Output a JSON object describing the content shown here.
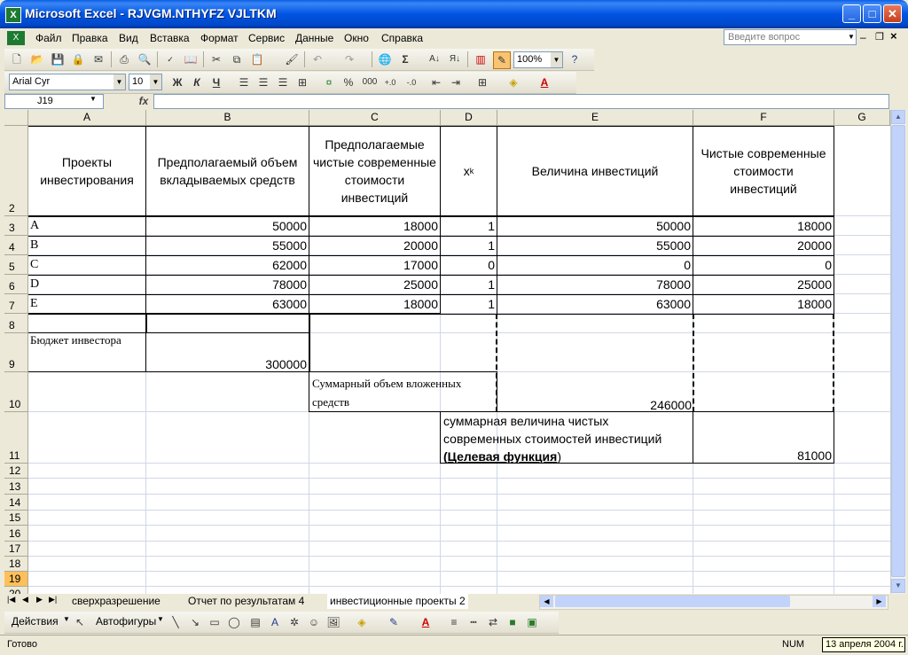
{
  "window": {
    "title": "Microsoft Excel - RJVGM.NTHYFZ VJLTKM",
    "icon": "excel-icon"
  },
  "menu": {
    "items": [
      "Файл",
      "Правка",
      "Вид",
      "Вставка",
      "Формат",
      "Сервис",
      "Данные",
      "Окно",
      "Справка"
    ],
    "help_placeholder": "Введите вопрос"
  },
  "toolbar": {
    "zoom": "100%",
    "font_name": "Arial Cyr",
    "font_size": "10",
    "bold": "Ж",
    "italic": "К",
    "underline": "Ч",
    "percent": "%",
    "thousands": "000",
    "sum": "Σ"
  },
  "formula_bar": {
    "name_box": "J19",
    "fx": "fx",
    "value": ""
  },
  "columns": [
    "A",
    "B",
    "C",
    "D",
    "E",
    "F",
    "G"
  ],
  "rows": [
    "2",
    "3",
    "4",
    "5",
    "6",
    "7",
    "8",
    "9",
    "10",
    "11",
    "12",
    "13",
    "14",
    "15",
    "16",
    "17",
    "18",
    "19",
    "20"
  ],
  "sheet": {
    "headers": {
      "a": "Проекты инвестирования",
      "b": "Предполагаемый объем  вкладываемых средств",
      "c": "Предполагаемые чистые современные стоимости инвестиций",
      "d_base": "x",
      "d_sub": "k",
      "e": "Величина инвестиций",
      "f": "Чистые современные стоимости инвестиций"
    },
    "data": [
      {
        "a": "A",
        "b": "50000",
        "c": "18000",
        "d": "1",
        "e": "50000",
        "f": "18000"
      },
      {
        "a": "B",
        "b": "55000",
        "c": "20000",
        "d": "1",
        "e": "55000",
        "f": "20000"
      },
      {
        "a": "C",
        "b": "62000",
        "c": "17000",
        "d": "0",
        "e": "0",
        "f": "0"
      },
      {
        "a": "D",
        "b": "78000",
        "c": "25000",
        "d": "1",
        "e": "78000",
        "f": "25000"
      },
      {
        "a": "E",
        "b": "63000",
        "c": "18000",
        "d": "1",
        "e": "63000",
        "f": "18000"
      }
    ],
    "budget_label": "Бюджет инвестора",
    "budget_value": "300000",
    "total_label": "Суммарный объем вложенных средств",
    "total_value": "246000",
    "npv_label_1": "суммарная величина чистых",
    "npv_label_2": "современных стоимостей инвестиций",
    "npv_label_open": "(",
    "npv_label_bold": "Целевая функция",
    "npv_label_close": ")",
    "npv_value": "81000"
  },
  "tabs": [
    "сверхразрешение",
    "Отчет по результатам 4",
    "инвестиционные проекты 2"
  ],
  "drawbar": {
    "actions": "Действия",
    "autoshapes": "Автофигуры"
  },
  "status": {
    "ready": "Готово",
    "num": "NUM",
    "date": "13 апреля 2004 г."
  }
}
